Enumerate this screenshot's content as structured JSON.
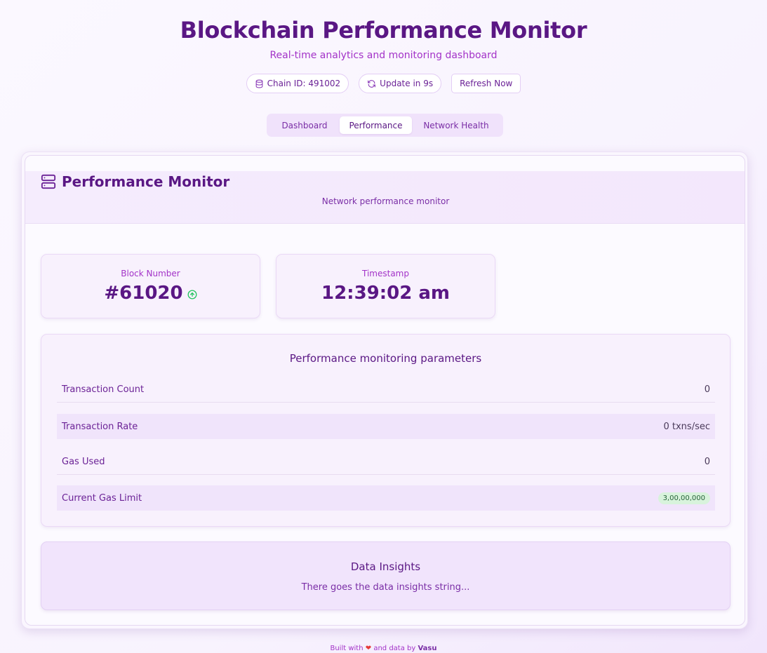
{
  "header": {
    "title": "Blockchain Performance Monitor",
    "subtitle": "Real-time analytics and monitoring dashboard",
    "chain_badge": "Chain ID: 491002",
    "update_badge": "Update in 9s",
    "refresh_label": "Refresh Now",
    "chain_icon": "database-icon",
    "update_icon": "refresh-icon"
  },
  "tabs": [
    {
      "label": "Dashboard",
      "active": false
    },
    {
      "label": "Performance",
      "active": true
    },
    {
      "label": "Network Health",
      "active": false
    }
  ],
  "card": {
    "title": "Performance Monitor",
    "subtitle": "Network performance monitor",
    "icon": "server-icon"
  },
  "stats": {
    "block_label": "Block Number",
    "block_value": "#61020",
    "block_trend_icon": "arrow-up-circle-icon",
    "time_label": "Timestamp",
    "time_value": "12:39:02 am"
  },
  "params": {
    "title": "Performance monitoring parameters",
    "rows": [
      {
        "label": "Transaction Count",
        "value": "0"
      },
      {
        "label": "Transaction Rate",
        "value": "0 txns/sec"
      },
      {
        "label": "Gas Used",
        "value": "0"
      },
      {
        "label": "Current Gas Limit",
        "value": "3,00,00,000"
      }
    ]
  },
  "insights": {
    "title": "Data Insights",
    "text": "There goes the data insights string..."
  },
  "footer": {
    "prefix": "Built with",
    "heart": "❤",
    "middle": "and data by",
    "author": "Vasu"
  },
  "colors": {
    "primary": "#5a1784",
    "accent": "#a333c8",
    "success": "#22c55e"
  }
}
